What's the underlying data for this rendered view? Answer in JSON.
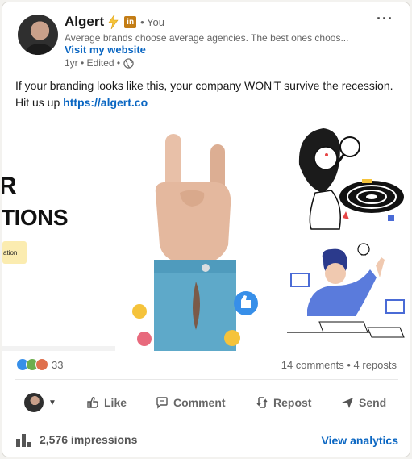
{
  "author": {
    "name": "Algert",
    "badge": "in",
    "degree": "• You",
    "headline": "Average brands choose average agencies. The best ones choos...",
    "website_link": "Visit my website",
    "time": "1yr • Edited •"
  },
  "post": {
    "text": "If your branding looks like this, your company WON'T survive the recession. Hit us up ",
    "link": "https://algert.co"
  },
  "media": {
    "left_line1": "R",
    "left_line2": "TIONS",
    "left_tag": "ation"
  },
  "social": {
    "reaction_count": "33",
    "comments_reposts": "14 comments • 4 reposts"
  },
  "actions": {
    "like": "Like",
    "comment": "Comment",
    "repost": "Repost",
    "send": "Send"
  },
  "footer": {
    "impressions": "2,576 impressions",
    "analytics": "View analytics"
  },
  "colors": {
    "link_blue": "#0a66c2",
    "badge_gold": "#c37d16",
    "bolt_yellow": "#f5c33b",
    "shirt_blue": "#5ea9c9"
  }
}
